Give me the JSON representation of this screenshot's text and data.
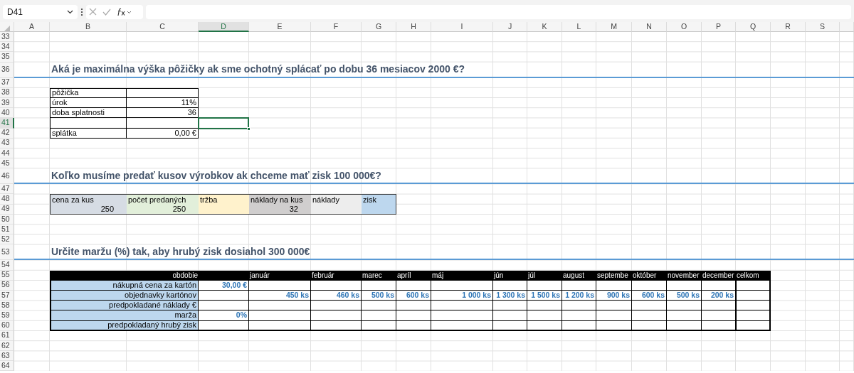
{
  "name_box": {
    "value": "D41"
  },
  "columns": [
    {
      "label": "A",
      "selected": false
    },
    {
      "label": "B",
      "selected": false
    },
    {
      "label": "C",
      "selected": false
    },
    {
      "label": "D",
      "selected": true
    },
    {
      "label": "E",
      "selected": false
    },
    {
      "label": "F",
      "selected": false
    },
    {
      "label": "G",
      "selected": false
    },
    {
      "label": "H",
      "selected": false
    },
    {
      "label": "I",
      "selected": false
    },
    {
      "label": "J",
      "selected": false
    },
    {
      "label": "K",
      "selected": false
    },
    {
      "label": "L",
      "selected": false
    },
    {
      "label": "M",
      "selected": false
    },
    {
      "label": "N",
      "selected": false
    },
    {
      "label": "O",
      "selected": false
    },
    {
      "label": "P",
      "selected": false
    },
    {
      "label": "Q",
      "selected": false
    },
    {
      "label": "R",
      "selected": false
    },
    {
      "label": "S",
      "selected": false
    }
  ],
  "rows": [
    {
      "label": "33",
      "selected": false
    },
    {
      "label": "34",
      "selected": false
    },
    {
      "label": "35",
      "selected": false
    },
    {
      "label": "36",
      "selected": false
    },
    {
      "label": "37",
      "selected": false
    },
    {
      "label": "38",
      "selected": false
    },
    {
      "label": "39",
      "selected": false
    },
    {
      "label": "40",
      "selected": false
    },
    {
      "label": "41",
      "selected": true
    },
    {
      "label": "42",
      "selected": false
    },
    {
      "label": "43",
      "selected": false
    },
    {
      "label": "44",
      "selected": false
    },
    {
      "label": "45",
      "selected": false
    },
    {
      "label": "46",
      "selected": false
    },
    {
      "label": "47",
      "selected": false
    },
    {
      "label": "48",
      "selected": false
    },
    {
      "label": "49",
      "selected": false
    },
    {
      "label": "50",
      "selected": false
    },
    {
      "label": "51",
      "selected": false
    },
    {
      "label": "52",
      "selected": false
    },
    {
      "label": "53",
      "selected": false
    },
    {
      "label": "54",
      "selected": false
    },
    {
      "label": "55",
      "selected": false
    },
    {
      "label": "56",
      "selected": false
    },
    {
      "label": "57",
      "selected": false
    },
    {
      "label": "58",
      "selected": false
    },
    {
      "label": "59",
      "selected": false
    },
    {
      "label": "60",
      "selected": false
    },
    {
      "label": "61",
      "selected": false
    },
    {
      "label": "62",
      "selected": false
    },
    {
      "label": "63",
      "selected": false
    },
    {
      "label": "64",
      "selected": false
    }
  ],
  "questions": [
    "Aká je maximálna výška pôžičky ak sme ochotný splácať po dobu 36 mesiacov 2000 €?",
    "Koľko musíme predať kusov výrobkov ak chceme mať zisk 100 000€?",
    "Určite maržu (%) tak, aby hrubý zisk dosiahol 300 000€"
  ],
  "loan_table": {
    "rows": [
      {
        "kind": "entry",
        "label": "pôžička"
      },
      {
        "kind": "entry",
        "label": "úrok",
        "value": "11%"
      },
      {
        "kind": "entry",
        "label": "doba splatnosti",
        "value": "36"
      },
      {
        "kind": "blank"
      },
      {
        "kind": "entry",
        "label": "splátka",
        "value": "0,00 €"
      }
    ]
  },
  "sales_table": {
    "columns": [
      {
        "label": "cena za kus",
        "value": "250",
        "color": "#d6dce4"
      },
      {
        "label": "počet predaných",
        "value": "250",
        "color": "#e2efda"
      },
      {
        "label": "tržba",
        "color": "#fff2cc"
      },
      {
        "label": "náklady na kus",
        "value": "32",
        "color": "#d0cece"
      },
      {
        "label": "náklady",
        "color": "#ededed"
      },
      {
        "label": "zisk",
        "color": "#bdd7ee"
      }
    ]
  },
  "margin_table": {
    "period_label": "obdobie",
    "months": [
      "január",
      "február",
      "marec",
      "apríl",
      "máj",
      "jún",
      "júl",
      "august",
      "septembe",
      "október",
      "november",
      "december",
      "celkom"
    ],
    "rows": [
      {
        "label": "nákupná cena za kartón",
        "input": "30,00 €"
      },
      {
        "label": "objednavky kartónov",
        "values": [
          "450 ks",
          "460 ks",
          "500 ks",
          "600 ks",
          "1 000 ks",
          "1 300 ks",
          "1 500 ks",
          "1 200 ks",
          "900 ks",
          "600 ks",
          "500 ks",
          "200 ks"
        ]
      },
      {
        "label": "predpokladané náklady €"
      },
      {
        "label": "marža",
        "input": "0%"
      },
      {
        "label": "predpokladaný hrubý zisk"
      }
    ]
  }
}
